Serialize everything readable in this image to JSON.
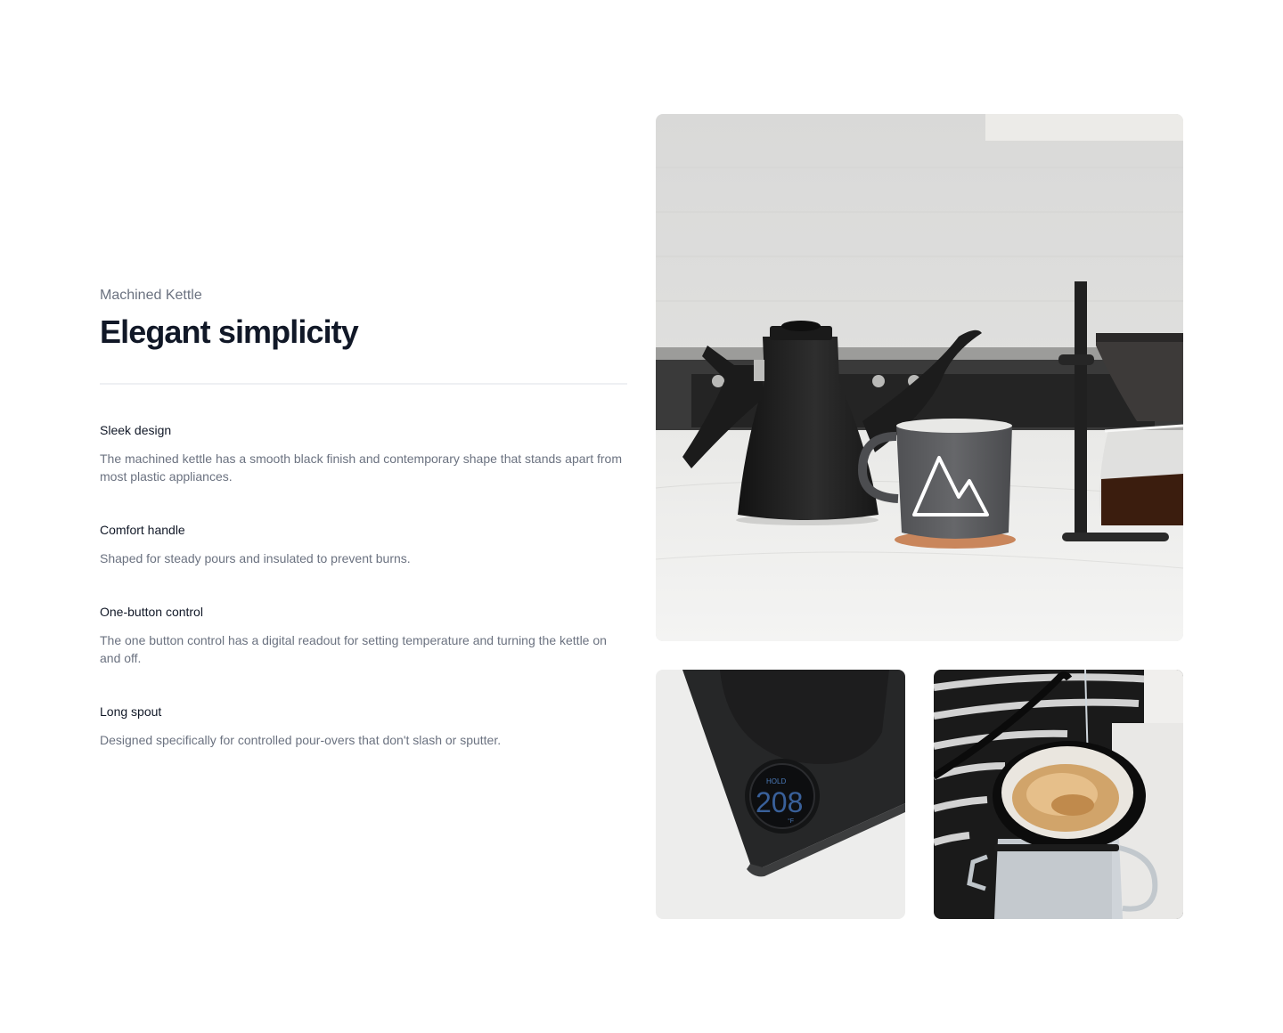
{
  "product": {
    "eyebrow": "Machined Kettle",
    "title": "Elegant simplicity"
  },
  "features": [
    {
      "name": "Sleek design",
      "description": "The machined kettle has a smooth black finish and contemporary shape that stands apart from most plastic appliances."
    },
    {
      "name": "Comfort handle",
      "description": "Shaped for steady pours and insulated to prevent burns."
    },
    {
      "name": "One-button control",
      "description": "The one button control has a digital readout for setting temperature and turning the kettle on and off."
    },
    {
      "name": "Long spout",
      "description": "Designed specifically for controlled pour-overs that don't slash or sputter."
    }
  ],
  "images": {
    "readout_label": "HOLD",
    "readout_value": "208",
    "readout_unit": "°F"
  },
  "colors": {
    "heading": "#111827",
    "muted": "#6b7280",
    "divider": "#eef0f3"
  }
}
